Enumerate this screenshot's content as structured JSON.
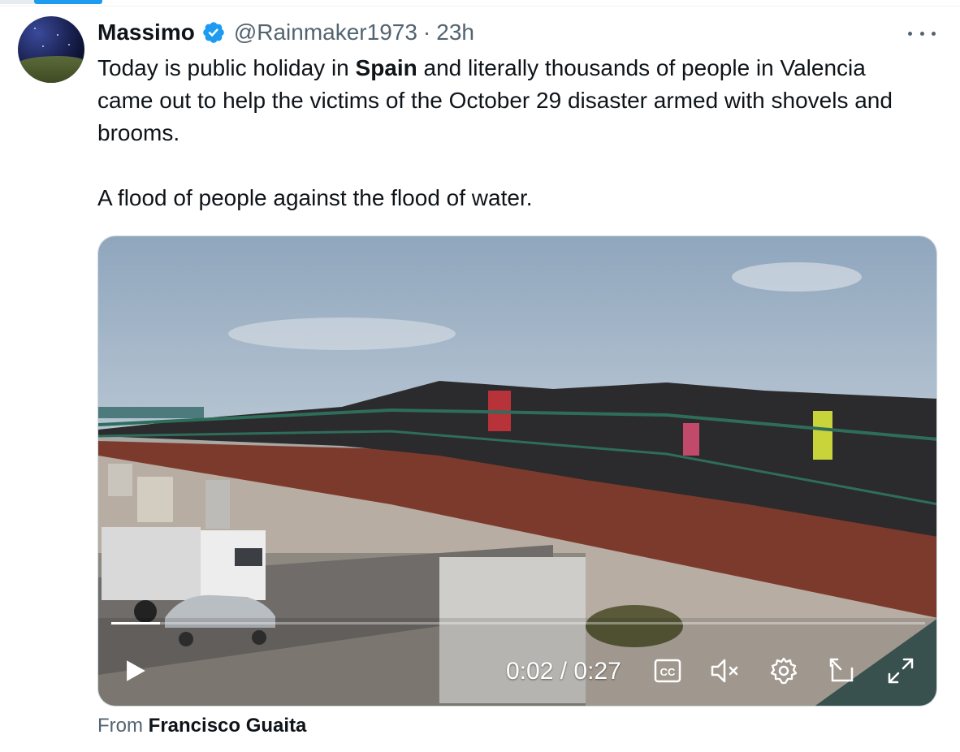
{
  "tweet": {
    "author_name": "Massimo",
    "handle": "@Rainmaker1973",
    "separator": "·",
    "time": "23h",
    "text_line1_before": "Today is public holiday in ",
    "text_bold": "Spain",
    "text_line1_after": " and literally thousands of people in Valencia came out to help the victims of the October 29 disaster armed with shovels and brooms.",
    "text_para2": "A flood of people against the flood of water.",
    "source_prefix": "From ",
    "source_name": "Francisco Guaita"
  },
  "video": {
    "current_time": "0:02",
    "duration": "0:27",
    "time_separator": " / ",
    "progress_fraction": 0.06,
    "muted": true
  },
  "icons": {
    "verified": "verified-badge-icon",
    "more": "more-icon",
    "play": "play-icon",
    "captions": "cc-icon",
    "mute": "mute-icon",
    "settings": "gear-icon",
    "pip": "pip-icon",
    "fullscreen": "fullscreen-icon"
  },
  "colors": {
    "accent": "#1d9bf0",
    "text": "#0f1419",
    "secondary": "#536471"
  }
}
